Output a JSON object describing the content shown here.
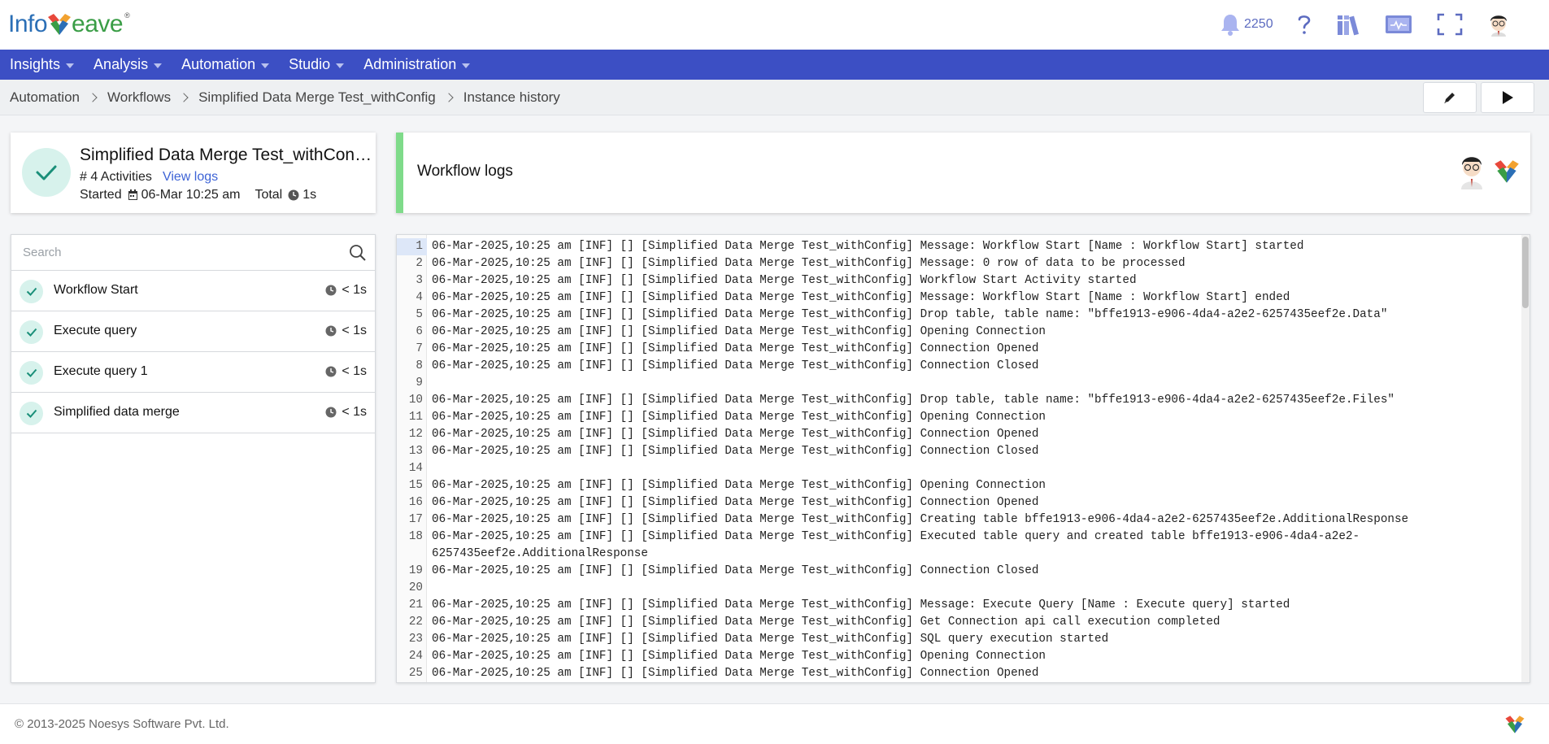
{
  "app": {
    "logo_prefix": "Info",
    "logo_suffix": "eave",
    "logo_reg": "®",
    "notification_count": "2250",
    "icons": [
      "bell-icon",
      "help-icon",
      "library-icon",
      "monitor-icon",
      "fullscreen-icon",
      "user-avatar"
    ]
  },
  "nav": {
    "items": [
      {
        "label": "Insights"
      },
      {
        "label": "Analysis"
      },
      {
        "label": "Automation"
      },
      {
        "label": "Studio"
      },
      {
        "label": "Administration"
      }
    ]
  },
  "breadcrumb": {
    "items": [
      "Automation",
      "Workflows",
      "Simplified Data Merge Test_withConfig",
      "Instance history"
    ]
  },
  "toolbar": {
    "edit_icon": "pencil-icon",
    "run_icon": "play-icon"
  },
  "summary": {
    "title": "Simplified Data Merge Test_withConfig",
    "activities_label": "# 4 Activities",
    "view_logs": "View logs",
    "started_label": "Started",
    "started_value": "06-Mar 10:25 am",
    "total_label": "Total",
    "total_value": "1s",
    "status": "success"
  },
  "logs_panel": {
    "title": "Workflow logs"
  },
  "search": {
    "placeholder": "Search"
  },
  "activities": [
    {
      "name": "Workflow Start",
      "duration": "< 1s"
    },
    {
      "name": "Execute query",
      "duration": "< 1s"
    },
    {
      "name": "Execute query 1",
      "duration": "< 1s"
    },
    {
      "name": "Simplified data merge",
      "duration": "< 1s"
    }
  ],
  "log_lines": [
    {
      "n": "1",
      "text": "06-Mar-2025,10:25 am [INF] [] [Simplified Data Merge Test_withConfig] Message: Workflow Start [Name : Workflow Start] started"
    },
    {
      "n": "2",
      "text": "06-Mar-2025,10:25 am [INF] [] [Simplified Data Merge Test_withConfig] Message: 0 row of data to be processed"
    },
    {
      "n": "3",
      "text": "06-Mar-2025,10:25 am [INF] [] [Simplified Data Merge Test_withConfig] Workflow Start Activity started"
    },
    {
      "n": "4",
      "text": "06-Mar-2025,10:25 am [INF] [] [Simplified Data Merge Test_withConfig] Message: Workflow Start [Name : Workflow Start] ended"
    },
    {
      "n": "5",
      "text": "06-Mar-2025,10:25 am [INF] [] [Simplified Data Merge Test_withConfig] Drop table, table name: \"bffe1913-e906-4da4-a2e2-6257435eef2e.Data\""
    },
    {
      "n": "6",
      "text": "06-Mar-2025,10:25 am [INF] [] [Simplified Data Merge Test_withConfig] Opening Connection"
    },
    {
      "n": "7",
      "text": "06-Mar-2025,10:25 am [INF] [] [Simplified Data Merge Test_withConfig] Connection Opened"
    },
    {
      "n": "8",
      "text": "06-Mar-2025,10:25 am [INF] [] [Simplified Data Merge Test_withConfig] Connection Closed"
    },
    {
      "n": "9",
      "text": ""
    },
    {
      "n": "10",
      "text": "06-Mar-2025,10:25 am [INF] [] [Simplified Data Merge Test_withConfig] Drop table, table name: \"bffe1913-e906-4da4-a2e2-6257435eef2e.Files\""
    },
    {
      "n": "11",
      "text": "06-Mar-2025,10:25 am [INF] [] [Simplified Data Merge Test_withConfig] Opening Connection"
    },
    {
      "n": "12",
      "text": "06-Mar-2025,10:25 am [INF] [] [Simplified Data Merge Test_withConfig] Connection Opened"
    },
    {
      "n": "13",
      "text": "06-Mar-2025,10:25 am [INF] [] [Simplified Data Merge Test_withConfig] Connection Closed"
    },
    {
      "n": "14",
      "text": ""
    },
    {
      "n": "15",
      "text": "06-Mar-2025,10:25 am [INF] [] [Simplified Data Merge Test_withConfig] Opening Connection"
    },
    {
      "n": "16",
      "text": "06-Mar-2025,10:25 am [INF] [] [Simplified Data Merge Test_withConfig] Connection Opened"
    },
    {
      "n": "17",
      "text": "06-Mar-2025,10:25 am [INF] [] [Simplified Data Merge Test_withConfig] Creating table bffe1913-e906-4da4-a2e2-6257435eef2e.AdditionalResponse"
    },
    {
      "n": "18",
      "text": "06-Mar-2025,10:25 am [INF] [] [Simplified Data Merge Test_withConfig] Executed table query and created table bffe1913-e906-4da4-a2e2-\n6257435eef2e.AdditionalResponse"
    },
    {
      "n": "19",
      "text": "06-Mar-2025,10:25 am [INF] [] [Simplified Data Merge Test_withConfig] Connection Closed"
    },
    {
      "n": "20",
      "text": ""
    },
    {
      "n": "21",
      "text": "06-Mar-2025,10:25 am [INF] [] [Simplified Data Merge Test_withConfig] Message: Execute Query [Name : Execute query] started"
    },
    {
      "n": "22",
      "text": "06-Mar-2025,10:25 am [INF] [] [Simplified Data Merge Test_withConfig] Get Connection api call execution completed"
    },
    {
      "n": "23",
      "text": "06-Mar-2025,10:25 am [INF] [] [Simplified Data Merge Test_withConfig] SQL query execution started"
    },
    {
      "n": "24",
      "text": "06-Mar-2025,10:25 am [INF] [] [Simplified Data Merge Test_withConfig] Opening Connection"
    },
    {
      "n": "25",
      "text": "06-Mar-2025,10:25 am [INF] [] [Simplified Data Merge Test_withConfig] Connection Opened"
    }
  ],
  "footer": {
    "copyright": "© 2013-2025 Noesys Software Pvt. Ltd."
  }
}
